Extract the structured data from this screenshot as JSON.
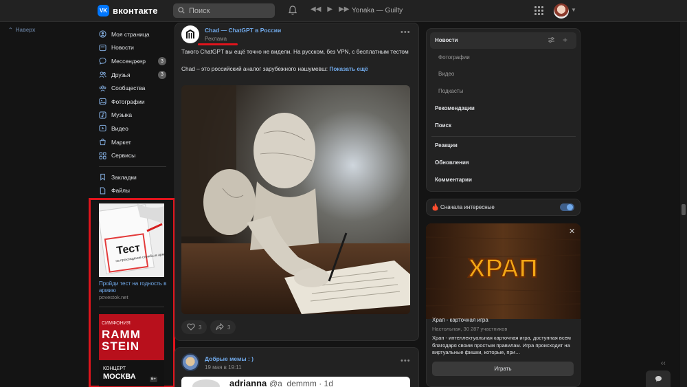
{
  "header": {
    "logo_text": "вконтакте",
    "logo_mark": "VK",
    "search_placeholder": "Поиск",
    "track": "Yonaka — Guilty"
  },
  "back_to_top": "Наверх",
  "nav": {
    "items": [
      {
        "label": "Моя страница",
        "icon": "user-circle-icon"
      },
      {
        "label": "Новости",
        "icon": "newspaper-icon"
      },
      {
        "label": "Мессенджер",
        "icon": "chat-icon",
        "badge": "3"
      },
      {
        "label": "Друзья",
        "icon": "friends-icon",
        "badge": "3"
      },
      {
        "label": "Сообщества",
        "icon": "communities-icon"
      },
      {
        "label": "Фотографии",
        "icon": "photo-icon"
      },
      {
        "label": "Музыка",
        "icon": "music-icon"
      },
      {
        "label": "Видео",
        "icon": "video-icon"
      },
      {
        "label": "Маркет",
        "icon": "market-icon"
      },
      {
        "label": "Сервисы",
        "icon": "services-icon"
      }
    ],
    "secondary": [
      {
        "label": "Закладки",
        "icon": "bookmark-icon"
      },
      {
        "label": "Файлы",
        "icon": "file-icon"
      }
    ]
  },
  "ads": {
    "ad1": {
      "image_text_big": "Тест",
      "image_text_small": "на прохождение службы в армии",
      "title": "Пройди тест на годность в армию",
      "url": "povestok.net"
    },
    "ad2": {
      "top_label": "СИМФОНИЯ",
      "band_line1": "RAMM",
      "band_line2": "STEIN",
      "concert": "КОНЦЕРТ",
      "city": "МОСКВА",
      "age": "6+"
    }
  },
  "post": {
    "author": "Chad — ChatGPT в России",
    "subtitle": "Реклама",
    "text_line1": "Такого ChatGPT вы ещё точно не видели. На русском, без VPN, с бесплатным тестом",
    "text_line2": "Chad – это российский аналог зарубежного нашумевш:",
    "show_more": "Показать ещё",
    "likes": "3",
    "shares": "3"
  },
  "post2": {
    "author": "Добрые мемы : )",
    "date": "19 мая в 19:11",
    "embed_name": "adrianna",
    "embed_handle": "@a_demmm · 1d"
  },
  "right": {
    "menu": {
      "news": "Новости",
      "photos": "Фотографии",
      "video": "Видео",
      "podcasts": "Подкасты",
      "recommendations": "Рекомендации",
      "search": "Поиск",
      "reactions": "Реакции",
      "updates": "Обновления",
      "comments": "Комментарии"
    },
    "sort_label": "Сначала интересные",
    "sort_enabled": true,
    "game": {
      "logo_text": "ХРАП",
      "title": "Храп - карточная игра",
      "meta": "Настольная, 30 287 участников",
      "description": "Храп - интеллектуальная карточная игра, доступная всем благодаря своим простым правилам. Игра происходит на виртуальные фишки, которые, при…",
      "button": "Играть"
    }
  },
  "colors": {
    "accent": "#71aaeb",
    "brand": "#0077ff",
    "highlight_red": "#e0141c",
    "background": "#141414",
    "panel": "#222222"
  }
}
